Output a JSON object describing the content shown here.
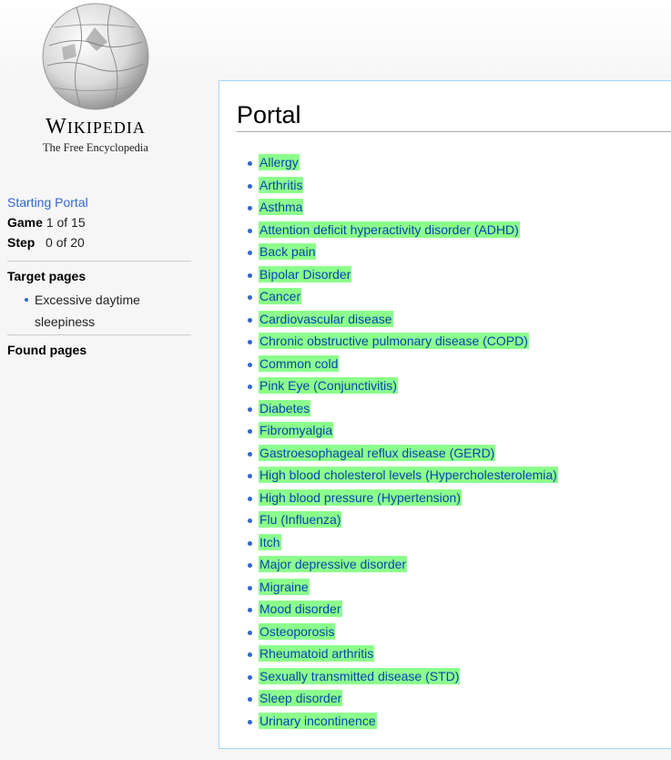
{
  "logo": {
    "wordmark": "Wikipedia",
    "tagline": "The Free Encyclopedia",
    "icon": "wikipedia-globe-icon"
  },
  "sidebar": {
    "starting_portal_link": "Starting Portal",
    "game_label": "Game",
    "game_value": "1 of 15",
    "step_label": "Step",
    "step_value": "0 of 20",
    "target_heading": "Target pages",
    "targets": [
      "Excessive daytime sleepiness"
    ],
    "found_heading": "Found pages"
  },
  "main": {
    "title": "Portal",
    "links": [
      "Allergy",
      "Arthritis",
      "Asthma",
      "Attention deficit hyperactivity disorder (ADHD)",
      "Back pain",
      "Bipolar Disorder",
      "Cancer",
      "Cardiovascular disease",
      "Chronic obstructive pulmonary disease (COPD)",
      "Common cold",
      "Pink Eye (Conjunctivitis)",
      "Diabetes",
      "Fibromyalgia",
      "Gastroesophageal reflux disease (GERD)",
      "High blood cholesterol levels (Hypercholesterolemia)",
      "High blood pressure (Hypertension)",
      "Flu (Influenza)",
      "Itch",
      "Major depressive disorder",
      "Migraine",
      "Mood disorder",
      "Osteoporosis",
      "Rheumatoid arthritis",
      "Sexually transmitted disease (STD)",
      "Sleep disorder",
      "Urinary incontinence"
    ]
  },
  "colors": {
    "link": "#0645ad",
    "highlight": "#8cff8c",
    "border": "#a7d7f9"
  }
}
